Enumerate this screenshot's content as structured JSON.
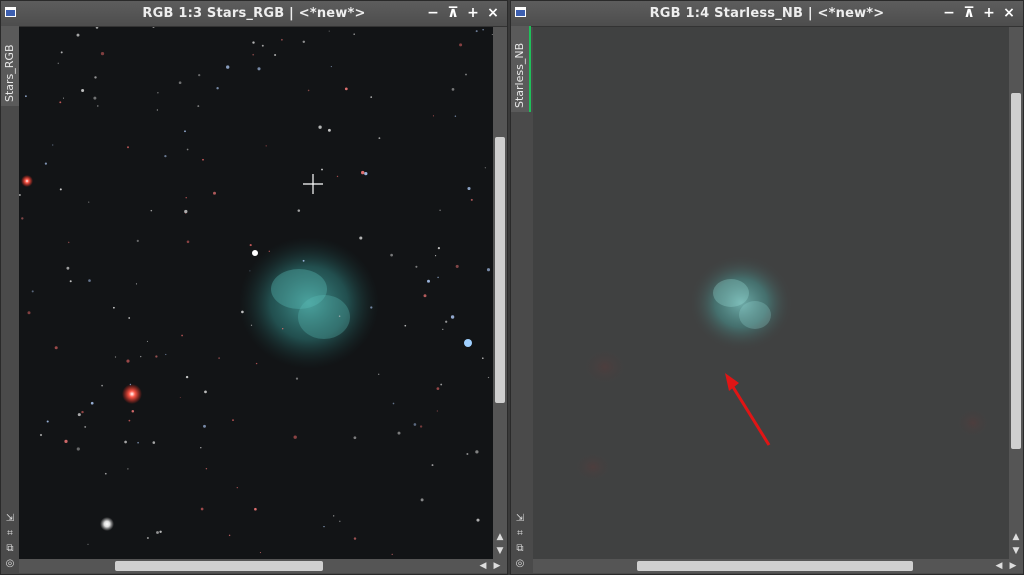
{
  "left_window": {
    "title": "RGB 1:3 Stars_RGB | <*new*>",
    "side_tab_label": "Stars_RGB",
    "controls": [
      "−",
      "⊼",
      "+",
      "×"
    ]
  },
  "right_window": {
    "title": "RGB 1:4 Starless_NB | <*new*>",
    "side_tab_label": "Starless_NB",
    "controls": [
      "−",
      "⊼",
      "+",
      "×"
    ]
  },
  "icons": {
    "app": "image-window-icon",
    "minimize": "minimize-icon",
    "shade": "shade-icon",
    "maximize": "maximize-icon",
    "close": "close-icon",
    "side_tools": [
      "fit-view-icon",
      "zoom-icon",
      "clone-icon",
      "target-icon"
    ]
  },
  "colors": {
    "stars_background": "#121416",
    "starless_background": "#404141",
    "nebula": "#3f9a98",
    "annotation_arrow": "#e01515"
  }
}
